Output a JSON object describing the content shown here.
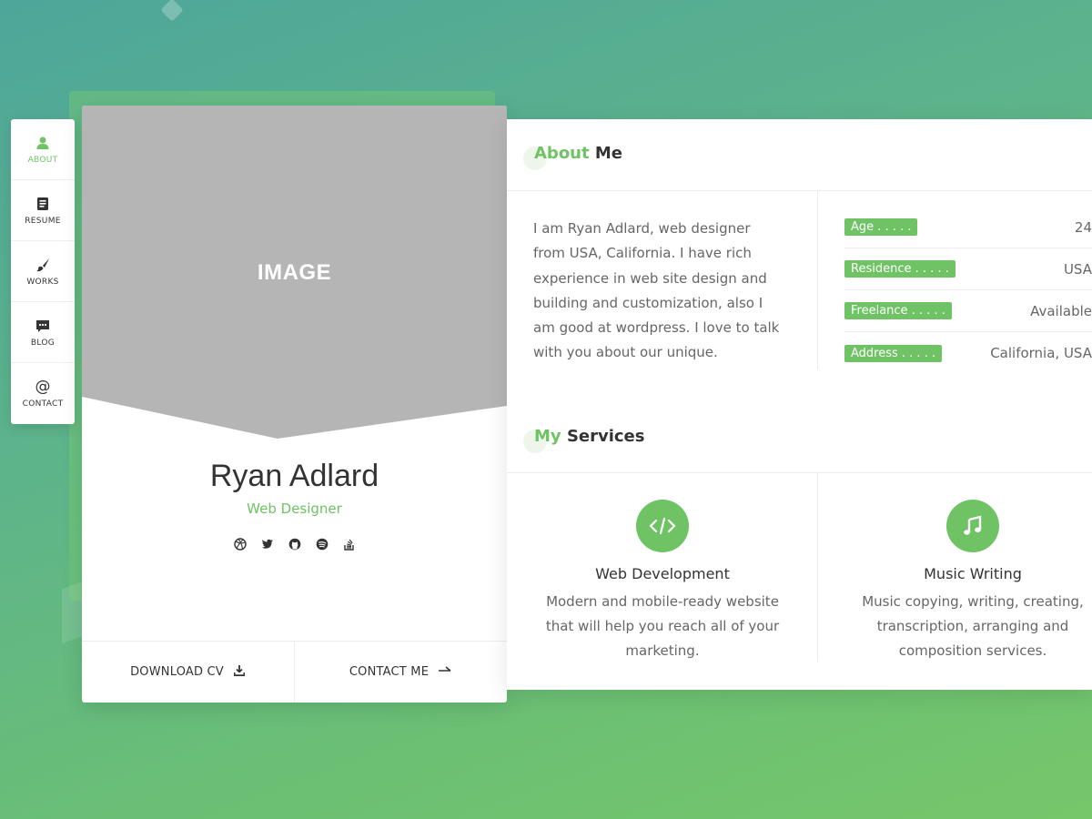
{
  "colors": {
    "accent": "#6fc365",
    "text": "#333333",
    "muted": "#666666",
    "image_placeholder": "#b5b5b5"
  },
  "nav": {
    "items": [
      {
        "label": "ABOUT",
        "icon": "user-icon",
        "active": true
      },
      {
        "label": "RESUME",
        "icon": "document-icon",
        "active": false
      },
      {
        "label": "WORKS",
        "icon": "paintbrush-icon",
        "active": false
      },
      {
        "label": "BLOG",
        "icon": "chat-bubble-icon",
        "active": false
      },
      {
        "label": "CONTACT",
        "icon": "at-sign-icon",
        "active": false
      }
    ]
  },
  "profile": {
    "image_label": "IMAGE",
    "name": "Ryan Adlard",
    "title": "Web Designer",
    "social": [
      "dribbble-icon",
      "twitter-icon",
      "github-icon",
      "spotify-icon",
      "stackoverflow-icon"
    ],
    "download_label": "DOWNLOAD CV",
    "contact_label": "CONTACT ME"
  },
  "about": {
    "title_accent": "About",
    "title_rest": "Me",
    "text_lines": [
      "I am Ryan Adlard, web designer",
      "from USA, California. I have rich",
      "experience in web site design and",
      "building and customization, also I",
      "am good at wordpress. I love to talk",
      "with you about our unique."
    ],
    "info": [
      {
        "key": "Age . . . . .",
        "value": "24"
      },
      {
        "key": "Residence . . . . .",
        "value": "USA"
      },
      {
        "key": "Freelance . . . . .",
        "value": "Available"
      },
      {
        "key": "Address . . . . .",
        "value": "California, USA"
      }
    ]
  },
  "services": {
    "title_accent": "My",
    "title_rest": "Services",
    "items": [
      {
        "name": "Web Development",
        "icon": "code-icon",
        "desc_lines": [
          "Modern and mobile-ready website",
          "that will help you reach all of your",
          "marketing."
        ]
      },
      {
        "name": "Music Writing",
        "icon": "music-note-icon",
        "desc_lines": [
          "Music copying, writing, creating,",
          "transcription, arranging and",
          "composition services."
        ]
      }
    ]
  }
}
